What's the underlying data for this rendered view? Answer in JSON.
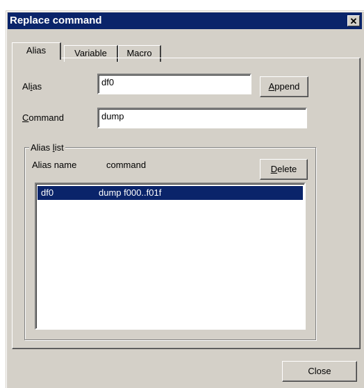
{
  "dialog": {
    "title": "Replace command",
    "close_glyph": "✕"
  },
  "tabs": [
    {
      "label": "Alias"
    },
    {
      "label": "Variable"
    },
    {
      "label": "Macro"
    }
  ],
  "alias_field": {
    "label_pre": "Al",
    "label_mnemonic": "i",
    "label_post": "as",
    "value": "df0"
  },
  "command_field": {
    "label_mnemonic": "C",
    "label_post": "ommand",
    "value": "dump"
  },
  "append_button": {
    "mnemonic": "A",
    "rest": "ppend"
  },
  "alias_list": {
    "group_label_pre": "Alias ",
    "group_label_mnemonic": "l",
    "group_label_post": "ist",
    "col_name": "Alias name",
    "col_command": "command",
    "delete_mnemonic": "D",
    "delete_rest": "elete",
    "rows": [
      {
        "name": "df0",
        "command": "dump f000..f01f",
        "selected": true
      }
    ]
  },
  "close_button": {
    "label": "Close"
  }
}
